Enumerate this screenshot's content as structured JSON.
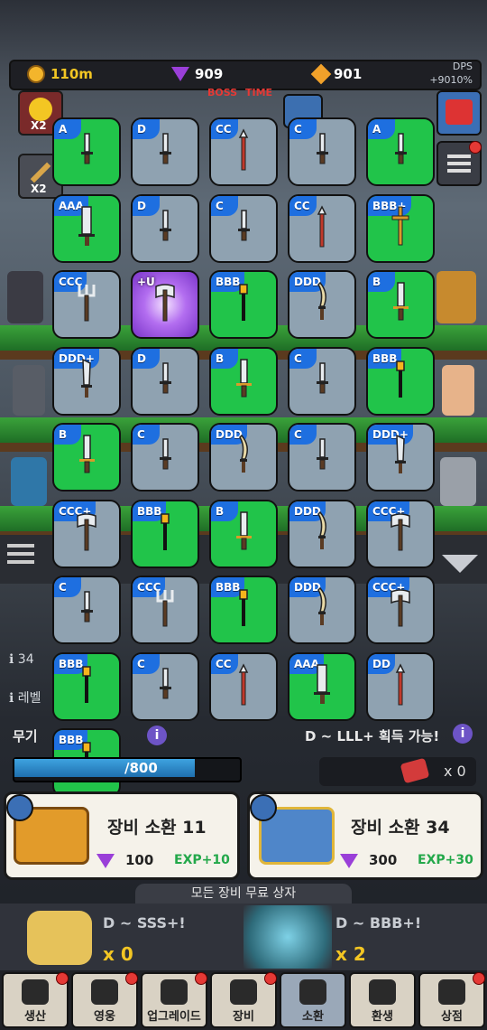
{
  "currency": {
    "gold": "110m",
    "gems": "909",
    "amber": "901",
    "dps_label": "DPS",
    "dps_value": "+9010%"
  },
  "side": {
    "left_top_mult": "X2",
    "left_mid_mult": "X2",
    "boss_label": "BOSS",
    "time_label": "TIME"
  },
  "grid": [
    [
      {
        "grade": "A",
        "bg": "green",
        "weapon": "dagger"
      },
      {
        "grade": "D",
        "bg": "gray",
        "weapon": "dagger"
      },
      {
        "grade": "CC",
        "bg": "gray",
        "weapon": "spear"
      },
      {
        "grade": "C",
        "bg": "gray",
        "weapon": "dagger"
      },
      {
        "grade": "A",
        "bg": "green",
        "weapon": "dagger"
      }
    ],
    [
      {
        "grade": "AAA",
        "bg": "green",
        "weapon": "greatsword"
      },
      {
        "grade": "D",
        "bg": "gray",
        "weapon": "dagger"
      },
      {
        "grade": "C",
        "bg": "gray",
        "weapon": "dagger"
      },
      {
        "grade": "CC",
        "bg": "gray",
        "weapon": "spear"
      },
      {
        "grade": "BBB+",
        "bg": "green",
        "weapon": "cross"
      }
    ],
    [
      {
        "grade": "CCC",
        "bg": "gray",
        "weapon": "trident"
      },
      {
        "grade": "+U",
        "bg": "purple",
        "weapon": "axe"
      },
      {
        "grade": "BBB",
        "bg": "green",
        "weapon": "torch"
      },
      {
        "grade": "DDD",
        "bg": "gray",
        "weapon": "curved"
      },
      {
        "grade": "B",
        "bg": "green",
        "weapon": "sword"
      }
    ],
    [
      {
        "grade": "DDD+",
        "bg": "gray",
        "weapon": "blade"
      },
      {
        "grade": "D",
        "bg": "gray",
        "weapon": "dagger"
      },
      {
        "grade": "B",
        "bg": "green",
        "weapon": "sword"
      },
      {
        "grade": "C",
        "bg": "gray",
        "weapon": "dagger"
      },
      {
        "grade": "BBB",
        "bg": "green",
        "weapon": "torch"
      }
    ],
    [
      {
        "grade": "B",
        "bg": "green",
        "weapon": "sword"
      },
      {
        "grade": "C",
        "bg": "gray",
        "weapon": "dagger"
      },
      {
        "grade": "DDD",
        "bg": "gray",
        "weapon": "curved"
      },
      {
        "grade": "C",
        "bg": "gray",
        "weapon": "dagger"
      },
      {
        "grade": "DDD+",
        "bg": "gray",
        "weapon": "blade"
      }
    ],
    [
      {
        "grade": "CCC+",
        "bg": "gray",
        "weapon": "axe"
      },
      {
        "grade": "BBB",
        "bg": "green",
        "weapon": "torch"
      },
      {
        "grade": "B",
        "bg": "green",
        "weapon": "sword"
      },
      {
        "grade": "DDD",
        "bg": "gray",
        "weapon": "curved"
      },
      {
        "grade": "CCC+",
        "bg": "gray",
        "weapon": "axe"
      }
    ],
    [
      {
        "grade": "C",
        "bg": "gray",
        "weapon": "dagger"
      },
      {
        "grade": "CCC",
        "bg": "gray",
        "weapon": "trident"
      },
      {
        "grade": "BBB",
        "bg": "green",
        "weapon": "torch"
      },
      {
        "grade": "DDD",
        "bg": "gray",
        "weapon": "curved"
      },
      {
        "grade": "CCC+",
        "bg": "gray",
        "weapon": "axe"
      }
    ],
    [
      {
        "grade": "BBB",
        "bg": "green",
        "weapon": "torch"
      },
      {
        "grade": "C",
        "bg": "gray",
        "weapon": "dagger"
      },
      {
        "grade": "CC",
        "bg": "gray",
        "weapon": "spear"
      },
      {
        "grade": "AAA",
        "bg": "green",
        "weapon": "greatsword"
      },
      {
        "grade": "DD",
        "bg": "gray",
        "weapon": "spear"
      }
    ],
    [
      {
        "grade": "BBB",
        "bg": "green",
        "weapon": "torch"
      }
    ]
  ],
  "info": {
    "line1": "34",
    "line2": "레벨",
    "weapon_label": "무기",
    "exp_text": "/800",
    "range_text": "D ~ LLL+ 획득 가능!",
    "ticket_count": "x 0"
  },
  "summon": [
    {
      "title": "장비 소환 11",
      "price": "100",
      "exp": "EXP+10"
    },
    {
      "title": "장비 소환 34",
      "price": "300",
      "exp": "EXP+30"
    }
  ],
  "free_box": {
    "title": "모든 장비 무료 상자",
    "left_range": "D ~ SSS+!",
    "left_count": "x 0",
    "right_range": "D ~ BBB+!",
    "right_count": "x 2"
  },
  "nav": [
    {
      "label": "생산",
      "icon": "anvil-icon",
      "dot": true
    },
    {
      "label": "영웅",
      "icon": "hero-icon",
      "dot": true
    },
    {
      "label": "업그레이드",
      "icon": "upgrade-icon",
      "dot": true
    },
    {
      "label": "장비",
      "icon": "bag-icon",
      "dot": true
    },
    {
      "label": "소환",
      "icon": "summon-icon",
      "dot": false
    },
    {
      "label": "환생",
      "icon": "hourglass-icon",
      "dot": false
    },
    {
      "label": "상점",
      "icon": "cart-icon",
      "dot": true
    }
  ],
  "colors": {
    "grade_badge": "#1e6fe0",
    "tile_green": "#21c44a",
    "tile_gray": "#8fa2b1",
    "exp_green": "#23a84a"
  }
}
